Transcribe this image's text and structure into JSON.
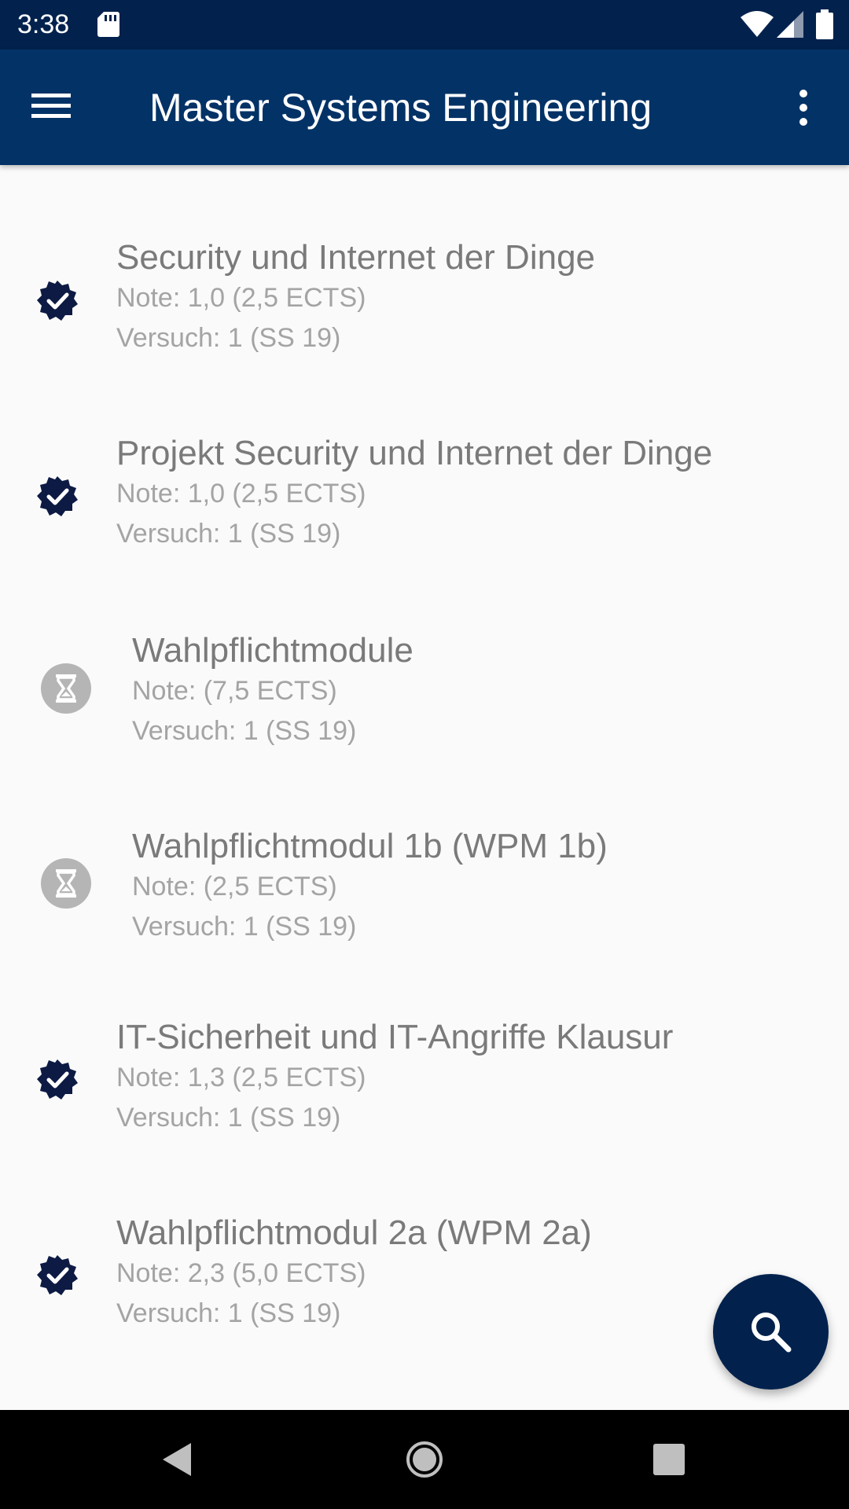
{
  "status_bar": {
    "time": "3:38",
    "icons": [
      "sd-card-icon",
      "wifi-icon",
      "signal-icon",
      "battery-icon"
    ]
  },
  "app_bar": {
    "title": "Master Systems Engineering",
    "menu_icon": "menu-icon",
    "overflow_icon": "more-vert-icon"
  },
  "colors": {
    "status_bar": "#02224d",
    "app_bar": "#033266",
    "fab": "#02224d",
    "check_icon": "#0d1a44",
    "pending_icon": "#b5b5b5"
  },
  "modules": [
    {
      "status": "passed",
      "status_icon": "verified-check-icon",
      "title": "Security und Internet der Dinge",
      "note": "Note: 1,0 (2,5 ECTS)",
      "attempt": "Versuch: 1 (SS 19)"
    },
    {
      "status": "passed",
      "status_icon": "verified-check-icon",
      "title": "Projekt Security und Internet der Dinge",
      "note": "Note: 1,0 (2,5 ECTS)",
      "attempt": "Versuch: 1 (SS 19)"
    },
    {
      "status": "pending",
      "status_icon": "hourglass-icon",
      "title": "Wahlpflichtmodule",
      "note": "Note:  (7,5 ECTS)",
      "attempt": "Versuch: 1 (SS 19)"
    },
    {
      "status": "pending",
      "status_icon": "hourglass-icon",
      "title": "Wahlpflichtmodul 1b (WPM 1b)",
      "note": "Note:  (2,5 ECTS)",
      "attempt": "Versuch: 1 (SS 19)"
    },
    {
      "status": "passed",
      "status_icon": "verified-check-icon",
      "title": "IT-Sicherheit und IT-Angriffe Klausur",
      "note": "Note: 1,3 (2,5 ECTS)",
      "attempt": "Versuch: 1 (SS 19)"
    },
    {
      "status": "passed",
      "status_icon": "verified-check-icon",
      "title": "Wahlpflichtmodul 2a (WPM 2a)",
      "note": "Note: 2,3 (5,0 ECTS)",
      "attempt": "Versuch: 1 (SS 19)"
    }
  ],
  "fab": {
    "icon": "search-icon"
  },
  "nav_bar": {
    "icons": [
      "back-icon",
      "home-icon",
      "recents-icon"
    ]
  }
}
